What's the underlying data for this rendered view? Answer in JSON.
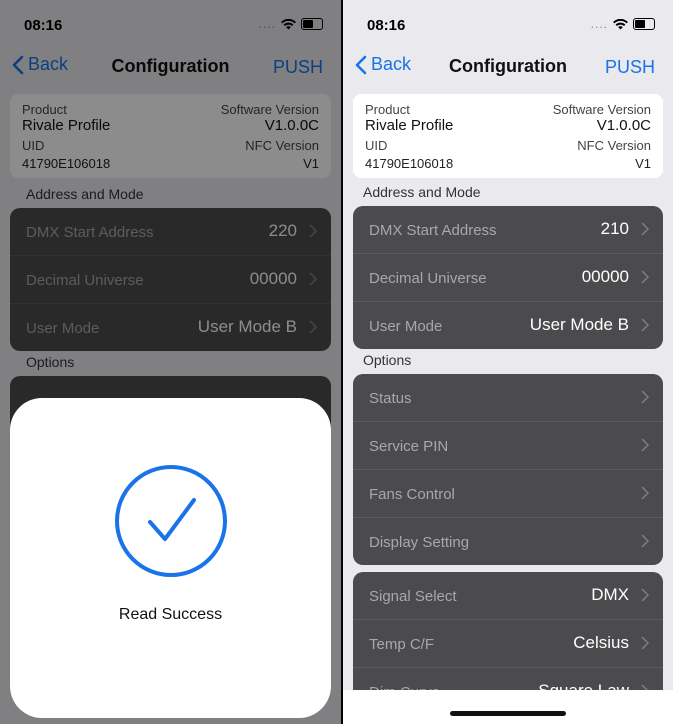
{
  "left": {
    "status": {
      "time": "08:16"
    },
    "nav": {
      "back": "Back",
      "title": "Configuration",
      "push": "PUSH"
    },
    "product": {
      "product_label": "Product",
      "product_value": "Rivale Profile",
      "software_label": "Software Version",
      "software_value": "V1.0.0C",
      "uid_label": "UID",
      "uid_value": "41790E106018",
      "nfc_label": "NFC Version",
      "nfc_value": "V1"
    },
    "address_header": "Address and Mode",
    "address": [
      {
        "label": "DMX Start Address",
        "value": "220"
      },
      {
        "label": "Decimal Universe",
        "value": "00000"
      },
      {
        "label": "User Mode",
        "value": "User Mode B"
      }
    ],
    "options_header": "Options",
    "modal": {
      "text": "Read Success",
      "icon": "check-circle-icon"
    }
  },
  "right": {
    "status": {
      "time": "08:16"
    },
    "nav": {
      "back": "Back",
      "title": "Configuration",
      "push": "PUSH"
    },
    "product": {
      "product_label": "Product",
      "product_value": "Rivale Profile",
      "software_label": "Software Version",
      "software_value": "V1.0.0C",
      "uid_label": "UID",
      "uid_value": "41790E106018",
      "nfc_label": "NFC Version",
      "nfc_value": "V1"
    },
    "address_header": "Address and Mode",
    "address": [
      {
        "label": "DMX Start Address",
        "value": "210"
      },
      {
        "label": "Decimal Universe",
        "value": "00000"
      },
      {
        "label": "User Mode",
        "value": "User Mode B"
      }
    ],
    "options_header": "Options",
    "options": [
      {
        "label": "Status"
      },
      {
        "label": "Service PIN"
      },
      {
        "label": "Fans Control"
      },
      {
        "label": "Display Setting"
      }
    ],
    "signal": [
      {
        "label": "Signal Select",
        "value": "DMX"
      },
      {
        "label": "Temp C/F",
        "value": "Celsius"
      },
      {
        "label": "Dim Curve",
        "value": "Square Law"
      }
    ]
  },
  "colors": {
    "accent": "#1a73e8",
    "cell_bg": "#4b4b4e",
    "page_bg": "#e9e9ee"
  }
}
